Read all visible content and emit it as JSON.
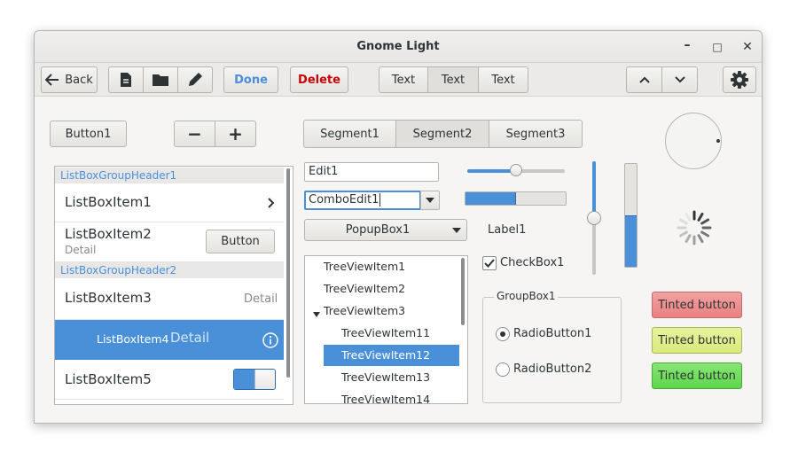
{
  "window": {
    "title": "Gnome Light",
    "minimize": "–",
    "maximize": "□",
    "close": "✕"
  },
  "toolbar": {
    "back_label": "Back",
    "done_label": "Done",
    "delete_label": "Delete",
    "text_buttons": [
      "Text",
      "Text",
      "Text"
    ]
  },
  "controls": {
    "button1": "Button1",
    "minus": "−",
    "plus": "+",
    "segments": [
      "Segment1",
      "Segment2",
      "Segment3"
    ],
    "active_segment": "Segment2",
    "edit1": "Edit1",
    "combo_edit": "ComboEdit1",
    "popup_box": "PopupBox1",
    "label1": "Label1",
    "checkbox_label": "CheckBox1",
    "checkbox_checked": true,
    "slider_value": 0.5,
    "progress_value": 0.5,
    "vslider_value": 0.5,
    "vprogress_value": 0.5
  },
  "listbox": {
    "header1": "ListBoxGroupHeader1",
    "header2": "ListBoxGroupHeader2",
    "item1": "ListBoxItem1",
    "item2": "ListBoxItem2",
    "item2_detail": "Detail",
    "item2_button": "Button",
    "item3": "ListBoxItem3",
    "item3_detail": "Detail",
    "item4": "ListBoxItem4",
    "item4_detail": "Detail",
    "item5": "ListBoxItem5",
    "item5_switch_on": true
  },
  "treeview": {
    "items": [
      "TreeViewItem1",
      "TreeViewItem2",
      "TreeViewItem3",
      "TreeViewItem11",
      "TreeViewItem12",
      "TreeViewItem13",
      "TreeViewItem14"
    ],
    "selected": "TreeViewItem12"
  },
  "groupbox": {
    "title": "GroupBox1",
    "radio1": "RadioButton1",
    "radio2": "RadioButton2",
    "selected": "RadioButton1"
  },
  "tinted_buttons": {
    "red": "Tinted button",
    "yellow": "Tinted button",
    "green": "Tinted button"
  },
  "colors": {
    "accent": "#4a90d9",
    "delete": "#cc0000",
    "tint_red": "#ee8a8a",
    "tint_yellow": "#dfee8a",
    "tint_green": "#6fdd5d"
  }
}
